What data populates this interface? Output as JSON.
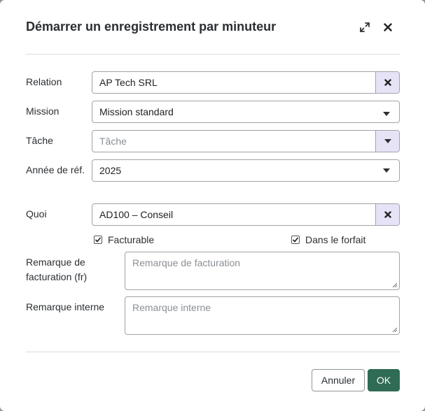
{
  "dialog": {
    "title": "Démarrer un enregistrement par minuteur",
    "expand_icon": "expand-icon",
    "close_icon": "close-icon"
  },
  "form": {
    "relation": {
      "label": "Relation",
      "value": "AP Tech SRL",
      "clear_icon": "clear-icon"
    },
    "mission": {
      "label": "Mission",
      "value": "Mission standard",
      "icon": "chevron-down-icon"
    },
    "tache": {
      "label": "Tâche",
      "placeholder": "Tâche",
      "icon": "chevron-down-icon"
    },
    "annee": {
      "label": "Année de réf.",
      "value": "2025",
      "icon": "chevron-down-icon"
    },
    "quoi": {
      "label": "Quoi",
      "value": "AD100 – Conseil",
      "clear_icon": "clear-icon"
    },
    "facturable": {
      "label": "Facturable",
      "checked": true
    },
    "forfait": {
      "label": "Dans le forfait",
      "checked": true
    },
    "remarque_facturation": {
      "label": "Remarque de facturation (fr)",
      "placeholder": "Remarque de facturation"
    },
    "remarque_interne": {
      "label": "Remarque interne",
      "placeholder": "Remarque interne"
    }
  },
  "footer": {
    "cancel_label": "Annuler",
    "ok_label": "OK"
  },
  "colors": {
    "primary": "#2f6b55",
    "side_button": "#e6e3f6"
  }
}
